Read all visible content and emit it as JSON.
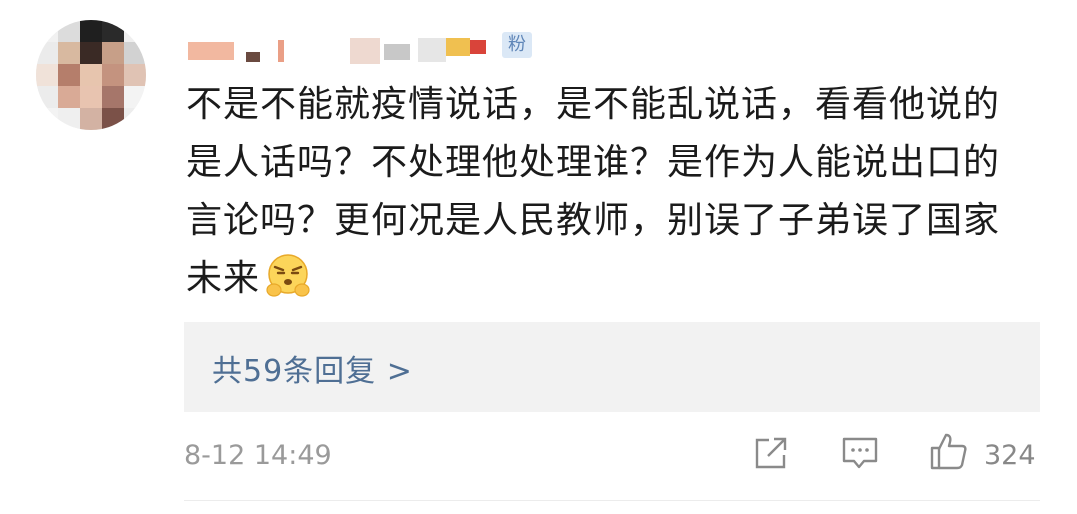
{
  "comment": {
    "badge_text": "粉",
    "text": "不是不能就疫情说话，是不能乱说话，看看他说的是人话吗？不处理他处理谁？是作为人能说出口的言论吗？更何况是人民教师，别误了子弟误了国家未来",
    "emoji": "sulking-face-emoji"
  },
  "replies": {
    "label": "共59条回复 >"
  },
  "footer": {
    "timestamp": "8-12 14:49",
    "share_icon": "share-icon",
    "comment_icon": "comment-icon",
    "like_icon": "thumbs-up-icon",
    "like_count": "324"
  },
  "colors": {
    "link": "#4f6f94",
    "meta": "#9a9a9a",
    "reply_bg": "#f2f2f2"
  }
}
